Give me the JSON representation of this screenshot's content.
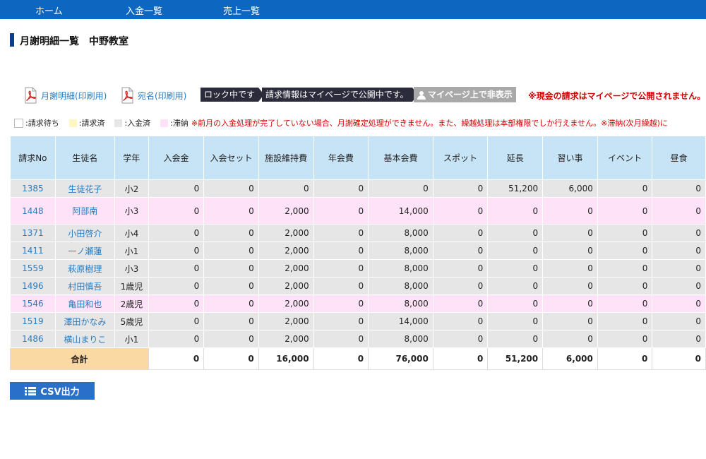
{
  "nav": {
    "home": "ホーム",
    "payments": "入金一覧",
    "sales": "売上一覧"
  },
  "page_title": "月謝明細一覧　中野教室",
  "actions": {
    "pdf_statement": "月謝明細(印刷用)",
    "pdf_address": "宛名(印刷用)",
    "locked": "ロック中です",
    "published": "請求情報はマイページで公開中です。",
    "hide_mypage": "マイページ上で非表示",
    "cash_warning": "※現金の請求はマイページで公開されません。"
  },
  "legend": {
    "waiting": ":請求待ち",
    "billed": ":請求済",
    "paid": ":入金済",
    "overdue": ":滞納",
    "note": "※前月の入金処理が完了していない場合、月謝確定処理ができません。また、繰越処理は本部権限でしか行えません。※滞納(次月繰越)に"
  },
  "colors": {
    "billed": "#fdf7c2",
    "paid": "#e6e6e6",
    "overdue": "#fde2f8",
    "total_label": "#fbd9a3"
  },
  "table": {
    "headers": [
      "請求No",
      "生徒名",
      "学年",
      "入会金",
      "入会セット",
      "施設維持費",
      "年会費",
      "基本会費",
      "スポット",
      "延長",
      "習い事",
      "イベント",
      "昼食"
    ],
    "rows": [
      {
        "status": "paid",
        "no": "1385",
        "name": "生徒花子",
        "grade": "小2",
        "cells": [
          "0",
          "0",
          "0",
          "0",
          "0",
          "0",
          "51,200",
          "6,000",
          "0",
          "0"
        ]
      },
      {
        "status": "late",
        "no": "1448",
        "name": "阿部南",
        "grade": "小3",
        "cells": [
          "0",
          "0",
          "2,000",
          "0",
          "14,000",
          "0",
          "0",
          "0",
          "0",
          "0"
        ]
      },
      {
        "status": "paid",
        "no": "1371",
        "name": "小田啓介",
        "grade": "小4",
        "cells": [
          "0",
          "0",
          "2,000",
          "0",
          "8,000",
          "0",
          "0",
          "0",
          "0",
          "0"
        ]
      },
      {
        "status": "paid",
        "no": "1411",
        "name": "一ノ瀬蓮",
        "grade": "小1",
        "cells": [
          "0",
          "0",
          "2,000",
          "0",
          "8,000",
          "0",
          "0",
          "0",
          "0",
          "0"
        ]
      },
      {
        "status": "paid",
        "no": "1559",
        "name": "萩原樹理",
        "grade": "小3",
        "cells": [
          "0",
          "0",
          "2,000",
          "0",
          "8,000",
          "0",
          "0",
          "0",
          "0",
          "0"
        ]
      },
      {
        "status": "paid",
        "no": "1496",
        "name": "村田慎吾",
        "grade": "1歳児",
        "cells": [
          "0",
          "0",
          "2,000",
          "0",
          "8,000",
          "0",
          "0",
          "0",
          "0",
          "0"
        ]
      },
      {
        "status": "lateshort",
        "no": "1546",
        "name": "亀田和也",
        "grade": "2歳児",
        "cells": [
          "0",
          "0",
          "2,000",
          "0",
          "8,000",
          "0",
          "0",
          "0",
          "0",
          "0"
        ]
      },
      {
        "status": "paid",
        "no": "1519",
        "name": "澤田かなみ",
        "grade": "5歳児",
        "cells": [
          "0",
          "0",
          "2,000",
          "0",
          "14,000",
          "0",
          "0",
          "0",
          "0",
          "0"
        ]
      },
      {
        "status": "paid",
        "no": "1486",
        "name": "横山まりこ",
        "grade": "小1",
        "cells": [
          "0",
          "0",
          "2,000",
          "0",
          "8,000",
          "0",
          "0",
          "0",
          "0",
          "0"
        ]
      }
    ],
    "total_label": "合計",
    "totals": [
      "0",
      "0",
      "16,000",
      "0",
      "76,000",
      "0",
      "51,200",
      "6,000",
      "0",
      "0"
    ]
  },
  "csv_button": "CSV出力"
}
